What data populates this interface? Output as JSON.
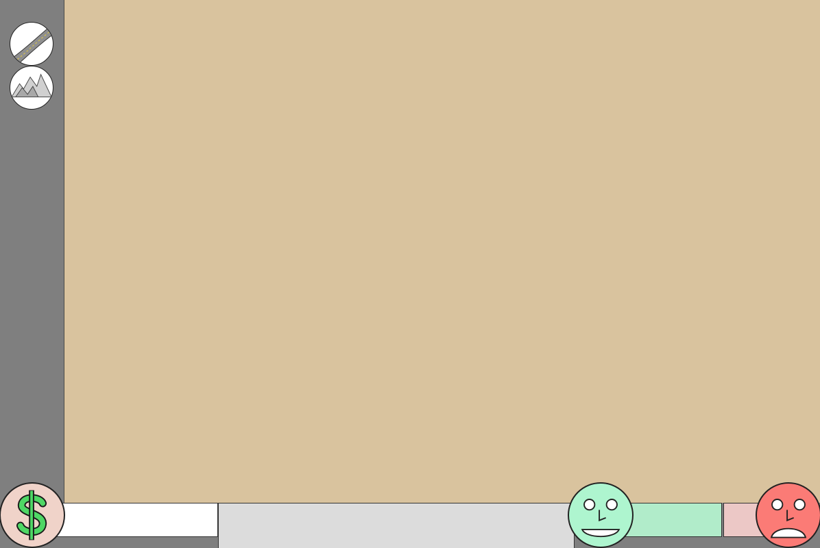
{
  "sidebar": {
    "tools": [
      {
        "name": "road-tool",
        "icon": "road-icon"
      },
      {
        "name": "terrain-tool",
        "icon": "mountains-icon"
      }
    ]
  },
  "map": {
    "background_color": "#d9c39e"
  },
  "status_bar": {
    "money": {
      "icon": "dollar-sign-icon",
      "level": 0
    },
    "happiness": {
      "icon": "happy-face-icon",
      "color": "#b1ecca"
    },
    "unhappiness": {
      "icon": "sad-face-icon",
      "color": "#fb7b76"
    }
  }
}
